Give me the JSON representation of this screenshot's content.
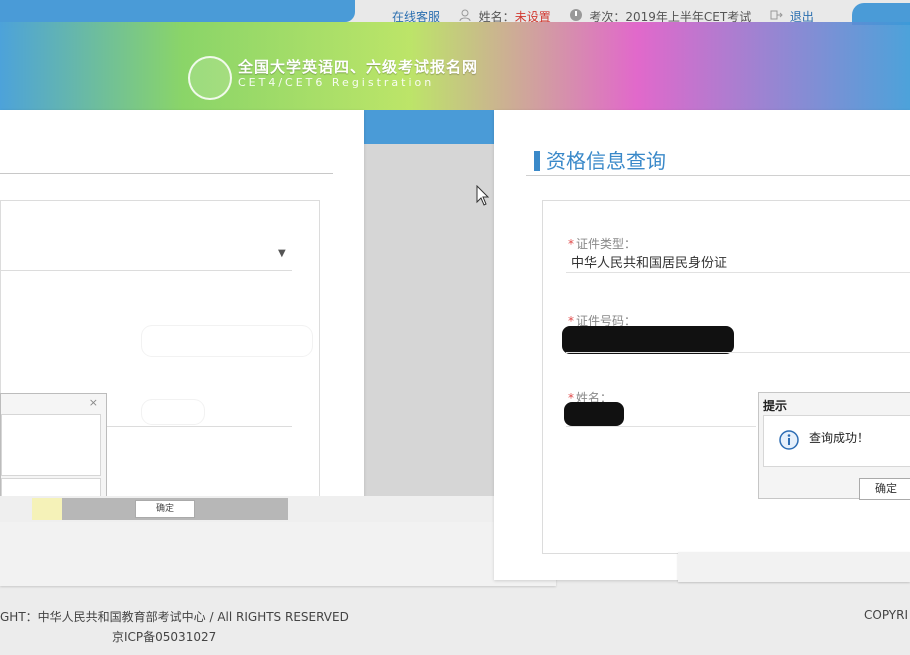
{
  "topnav": {
    "service": "在线客服",
    "name_label": "姓名：",
    "name_value": "未设置",
    "exam_label": "考次：2019年上半年CET考试",
    "logout": "退出"
  },
  "banner": {
    "title": "全国大学英语四、六级考试报名网",
    "subtitle": "CET4/CET6  Registration"
  },
  "right_panel": {
    "title": "资格信息查询",
    "fields": [
      {
        "label": "证件类型：",
        "value": "中华人民共和国居民身份证"
      },
      {
        "label": "证件号码：",
        "value": ""
      },
      {
        "label": "姓名：",
        "value": ""
      }
    ]
  },
  "left_panel": {
    "mini_dialog_close": "×",
    "button_label": "确定"
  },
  "dialog": {
    "title": "提示",
    "message": "查询成功！",
    "ok_label": "确定"
  },
  "footer": {
    "copyright_left": "GHT：中华人民共和国教育部考试中心 / All RIGHTS RESERVED",
    "icp": "京ICP备05031027",
    "copyright_right": "COPYRI"
  },
  "colors": {
    "accent": "#3a89c9",
    "nav_blue": "#4a9bd7",
    "warn": "#d1382f"
  }
}
